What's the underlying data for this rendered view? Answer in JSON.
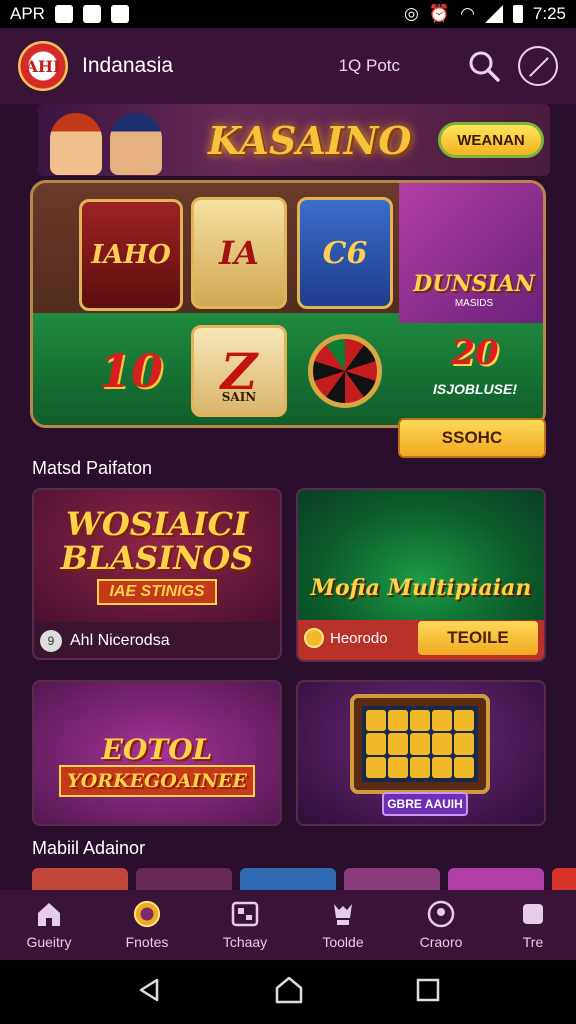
{
  "status_bar": {
    "carrier": "APR",
    "time": "7:25"
  },
  "header": {
    "logo_text": "AHI",
    "title": "Indanasia",
    "lang": "1Q Potc",
    "icons": [
      "search-icon",
      "compass-icon"
    ]
  },
  "hero": {
    "title": "KASAINO",
    "cta": "WEANAN"
  },
  "slot": {
    "reel1": "IAHO",
    "reel2": "IA",
    "reel3": "C6",
    "reel4": "10",
    "reel5": "Z",
    "reel5_sub": "SAIN",
    "promo_title": "DUNSIAN",
    "promo_sub": "MASIDS",
    "jackpot_number": "20",
    "jackpot_label": "ISJOBLUSE!",
    "play_button": "SSOHC"
  },
  "section1": {
    "title": "Matsd Paifaton"
  },
  "cards": [
    {
      "title": "WOSIAICI BLASINOS",
      "subtitle": "IAE STINIGS",
      "meta_icon": "9",
      "meta": "Ahl Nicerodsa"
    },
    {
      "title": "Mofia Multipiaian",
      "label": "Heorodo",
      "button": "TEOILE"
    },
    {
      "title": "EOTOL",
      "subtitle": "YORKEGOAINEE"
    },
    {
      "button": "GBRE AAUIH"
    }
  ],
  "section2": {
    "title": "Mabiil Adainor"
  },
  "bottom_nav": [
    {
      "label": "Gueitry",
      "icon": "home-icon"
    },
    {
      "label": "Fnotes",
      "icon": "chip-icon"
    },
    {
      "label": "Tchaay",
      "icon": "grid-icon"
    },
    {
      "label": "Toolde",
      "icon": "trophy-icon"
    },
    {
      "label": "Craoro",
      "icon": "profile-icon"
    },
    {
      "label": "Tre",
      "icon": "more-icon"
    }
  ],
  "colors": {
    "background": "#2a0f2c",
    "bar": "#3a1438",
    "gold": "#ffd24a",
    "accent_green": "#1f8a3e"
  }
}
